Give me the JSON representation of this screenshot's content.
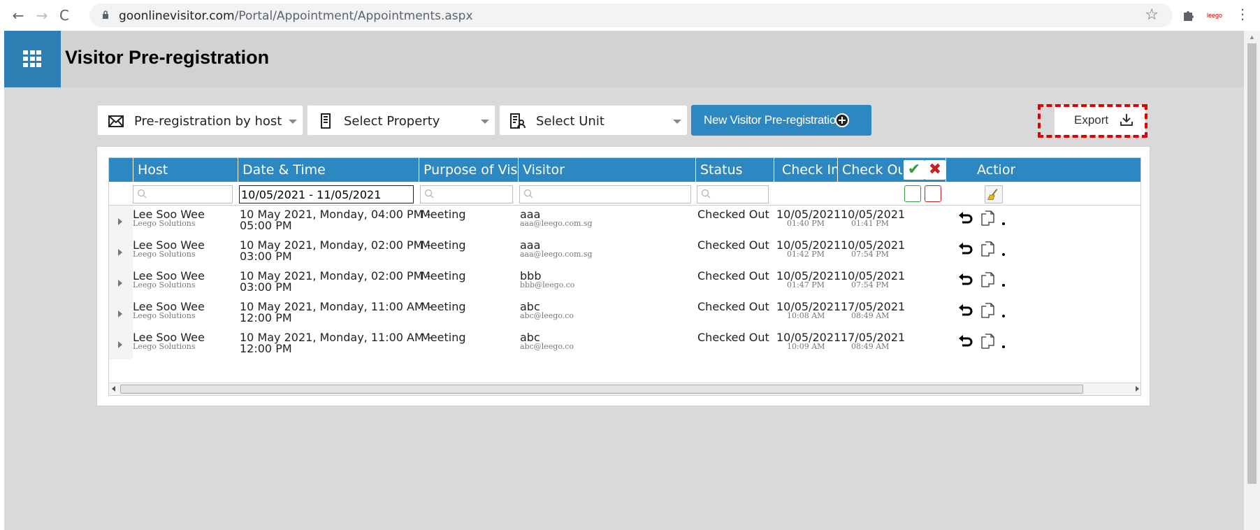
{
  "browser": {
    "url_domain": "goonlinevisitor.com",
    "url_path": "/Portal/Appointment/Appointments.aspx",
    "nav_back": "←",
    "nav_forward": "→",
    "nav_reload": "C",
    "star": "☆",
    "menu": "⋮",
    "extension_logo_text": "leego"
  },
  "header": {
    "title": "Visitor Pre-registration"
  },
  "toolbar": {
    "mode_dropdown": "Pre-registration by host",
    "property_dropdown": "Select Property",
    "unit_dropdown": "Select Unit",
    "new_button": "New Visitor Pre-registration",
    "export_button": "Export"
  },
  "grid": {
    "columns": [
      "Host",
      "Date & Time",
      "Purpose of Visit",
      "Visitor",
      "Status",
      "Check In",
      "Check Out",
      "Action"
    ],
    "check_all_ok": "✔",
    "check_all_x": "✖",
    "date_filter_value": "10/05/2021 - 11/05/2021",
    "rows": [
      {
        "host": "Lee Soo Wee",
        "company": "Leego Solutions",
        "datetime_1": "10 May 2021, Monday, 04:00 PM -",
        "datetime_2": "05:00 PM",
        "purpose": "Meeting",
        "visitor": "aaa",
        "visitor_email": "aaa@leego.com.sg",
        "status": "Checked Out",
        "checkin_date": "10/05/2021",
        "checkin_time": "01:40 PM",
        "checkout_date": "10/05/2021",
        "checkout_time": "01:41 PM"
      },
      {
        "host": "Lee Soo Wee",
        "company": "Leego Solutions",
        "datetime_1": "10 May 2021, Monday, 02:00 PM -",
        "datetime_2": "03:00 PM",
        "purpose": "Meeting",
        "visitor": "aaa",
        "visitor_email": "aaa@leego.com.sg",
        "status": "Checked Out",
        "checkin_date": "10/05/2021",
        "checkin_time": "01:42 PM",
        "checkout_date": "10/05/2021",
        "checkout_time": "07:54 PM"
      },
      {
        "host": "Lee Soo Wee",
        "company": "Leego Solutions",
        "datetime_1": "10 May 2021, Monday, 02:00 PM -",
        "datetime_2": "03:00 PM",
        "purpose": "Meeting",
        "visitor": "bbb",
        "visitor_email": "bbb@leego.co",
        "status": "Checked Out",
        "checkin_date": "10/05/2021",
        "checkin_time": "01:47 PM",
        "checkout_date": "10/05/2021",
        "checkout_time": "07:54 PM"
      },
      {
        "host": "Lee Soo Wee",
        "company": "Leego Solutions",
        "datetime_1": "10 May 2021, Monday, 11:00 AM -",
        "datetime_2": "12:00 PM",
        "purpose": "Meeting",
        "visitor": "abc",
        "visitor_email": "abc@leego.co",
        "status": "Checked Out",
        "checkin_date": "10/05/2021",
        "checkin_time": "10:08 AM",
        "checkout_date": "17/05/2021",
        "checkout_time": "08:49 AM"
      },
      {
        "host": "Lee Soo Wee",
        "company": "Leego Solutions",
        "datetime_1": "10 May 2021, Monday, 11:00 AM -",
        "datetime_2": "12:00 PM",
        "purpose": "Meeting",
        "visitor": "abc",
        "visitor_email": "abc@leego.co",
        "status": "Checked Out",
        "checkin_date": "10/05/2021",
        "checkin_time": "10:09 AM",
        "checkout_date": "17/05/2021",
        "checkout_time": "08:49 AM"
      }
    ]
  },
  "colors": {
    "accent": "#2d87c0",
    "apps_tile": "#2d7fb3",
    "highlight": "#e00000",
    "check_green": "#2e9e3a",
    "check_red": "#cc1f1f"
  }
}
